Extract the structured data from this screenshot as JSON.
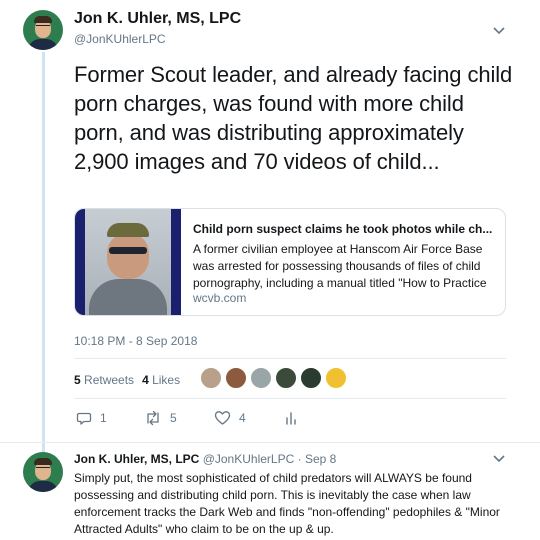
{
  "tweet": {
    "author_name": "Jon K. Uhler, MS, LPC",
    "author_handle": "@JonKUhlerLPC",
    "text": "Former Scout leader, and already facing child porn charges, was found with more child porn, and was distributing approximately 2,900 images and 70 videos of child...",
    "card": {
      "title": "Child porn suspect claims he took photos while ch...",
      "description": "A former civilian employee at Hanscom Air Force Base was arrested for possessing thousands of files of child pornography, including a manual titled \"How to Practice",
      "domain": "wcvb.com"
    },
    "timestamp": "10:18 PM - 8 Sep 2018",
    "retweets_count": "5",
    "retweets_label": "Retweets",
    "likes_count": "4",
    "likes_label": "Likes",
    "liker_colors": [
      "#b8a08a",
      "#8c5a3c",
      "#9aa5a8",
      "#3c4a3a",
      "#2a3c2e",
      "#f0c030"
    ],
    "actions": {
      "reply_count": "1",
      "retweet_count": "5",
      "like_count": "4"
    },
    "icons": [
      "chevron-down-icon",
      "reply-icon",
      "retweet-icon",
      "heart-icon",
      "analytics-icon"
    ]
  },
  "reply": {
    "author_name": "Jon K. Uhler, MS, LPC",
    "author_handle": "@JonKUhlerLPC",
    "separator": "·",
    "date": "Sep 8",
    "text": "Simply put, the most sophisticated of child predators will ALWAYS be found possessing and distributing child porn. This is inevitably the case when law enforcement tracks the Dark Web and finds \"non-offending\" pedophiles & \"Minor Attracted Adults\" who claim to be on the up & up."
  },
  "colors": {
    "text": "#14171a",
    "secondary": "#657786",
    "border": "#e6ecf0",
    "thread_line": "#cfe3f3",
    "card_image_border": "#1a1f6e"
  }
}
